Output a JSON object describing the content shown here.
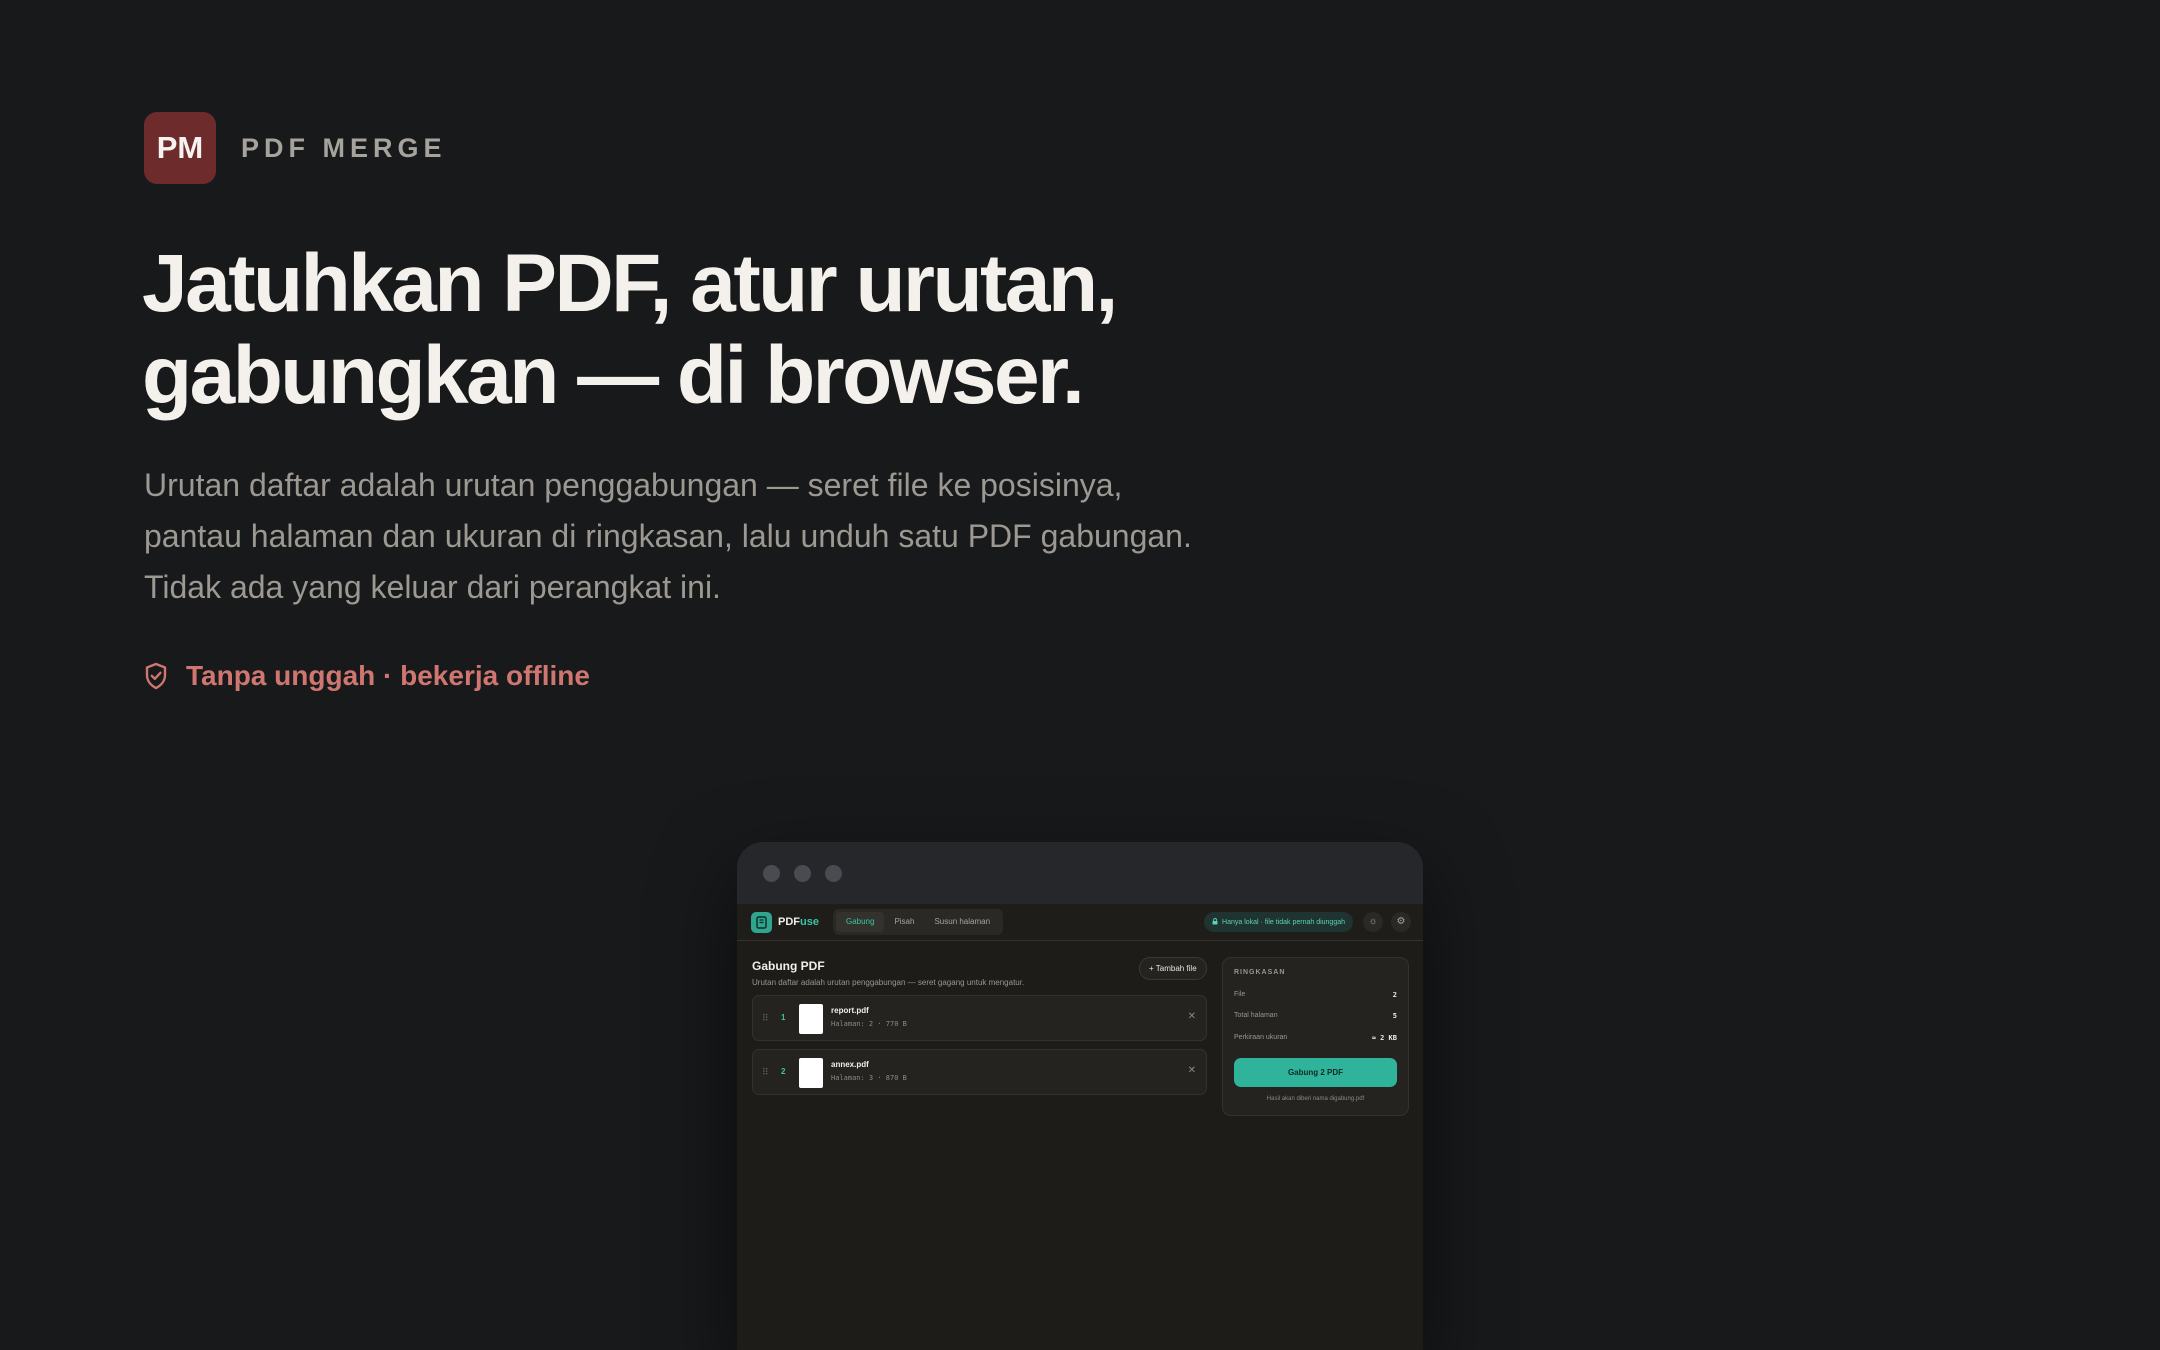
{
  "brand": {
    "initials": "PM",
    "name": "PDF MERGE"
  },
  "hero": {
    "headline_lines": [
      "Jatuhkan PDF, atur urutan,",
      "gabungkan — di browser."
    ],
    "lead_lines": [
      "Urutan daftar adalah urutan penggabungan — seret file ke posisinya,",
      "pantau halaman dan ukuran di ringkasan, lalu unduh satu PDF gabungan.",
      "Tidak ada yang keluar dari perangkat ini."
    ],
    "trust_label": "Tanpa unggah · bekerja offline"
  },
  "app": {
    "name_prefix": "PDF",
    "name_suffix": "use",
    "tabs": [
      {
        "label": "Gabung"
      },
      {
        "label": "Pisah"
      },
      {
        "label": "Susun halaman"
      }
    ],
    "local_pill": "Hanya lokal · file tidak pernah diunggah",
    "section_title": "Gabung PDF",
    "section_subtitle": "Urutan daftar adalah urutan penggabungan — seret gagang untuk mengatur.",
    "add_button": "+ Tambah file",
    "files": [
      {
        "index": "1",
        "name": "report.pdf",
        "meta": "Halaman: 2 · 770 B"
      },
      {
        "index": "2",
        "name": "annex.pdf",
        "meta": "Halaman: 3 · 870 B"
      }
    ],
    "summary": {
      "title": "RINGKASAN",
      "rows": [
        {
          "label": "File",
          "value": "2"
        },
        {
          "label": "Total halaman",
          "value": "5"
        },
        {
          "label": "Perkiraan ukuran",
          "value": "≈ 2 KB"
        }
      ],
      "merge_button": "Gabung 2 PDF",
      "note": "Hasil akan diberi nama digabung.pdf"
    }
  },
  "colors": {
    "background": "#18191b",
    "brand_badge": "#6e2b2c",
    "trust_accent": "#cf7670",
    "app_accent": "#2fb39a"
  }
}
